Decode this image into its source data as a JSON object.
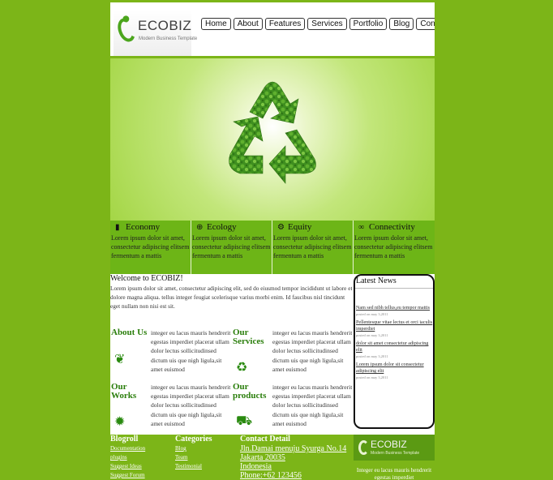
{
  "logo": {
    "name": "ECOBIZ",
    "tagline": "Modern Business Template"
  },
  "nav": [
    "Home",
    "About",
    "Features",
    "Services",
    "Portfolio",
    "Blog",
    "Contact"
  ],
  "colors": {
    "background": "#7cb518",
    "feature_bg": "#6db517",
    "heading_green": "#2a7e0b"
  },
  "features": [
    {
      "icon": "bar-chart-icon",
      "title": "Economy",
      "text": "Lorem ipsum dolor sit amet, consectetur adipiscing elitsem fermentum a mattis"
    },
    {
      "icon": "globe-icon",
      "title": "Ecology",
      "text": "Lorem ipsum dolor sit amet, consectetur adipiscing elitsem fermentum a mattis"
    },
    {
      "icon": "gears-icon",
      "title": "Equity",
      "text": "Lorem ipsum dolor sit amet, consectetur adipiscing elitsem fermentum a mattis"
    },
    {
      "icon": "link-icon",
      "title": "Connectivity",
      "text": "Lorem ipsum dolor sit amet, consectetur adipiscing elitsem fermentum a mattis"
    }
  ],
  "welcome": {
    "title": "Welcome to ECOBIZ!",
    "text": "Lorem ipsum dolor sit amet, consectetur adipiscing elit, sed do eiusmod tempor incididunt ut labore et dolore magna aliqua. tellus integer feugiat scelerisque varius morbi enim. Id faucibus nisl tincidunt eget nullam non nisi est sit."
  },
  "info_blocks": [
    {
      "title": "About Us",
      "icon": "leaf-icon",
      "text": "integer eu lacus mauris hendrerit egestas imperdiet placerat ullam dolor lectus sollicitudinsed dictum uis que nigh ligula,sit amet euismod"
    },
    {
      "title": "Our Services",
      "icon": "recycle-icon",
      "text": "integer eu lacus mauris hendrerit egestas imperdiet placerat ullam dolor lectus sollicitudinsed dictum uis que nigh ligula,sit amet euismod"
    },
    {
      "title": "Our Works",
      "icon": "gear-icon",
      "text": "integer eu lacus mauris hendrerit egestas imperdiet placerat ullam dolor lectus sollicitudinsed dictum uis que nigh ligula,sit amet euismod"
    },
    {
      "title": "Our products",
      "icon": "bus-icon",
      "text": "integer eu lacus mauris hendrerit egestas imperdiet placerat ullam dolor lectus sollicitudinsed dictum uis que nigh ligula,sit amet euismod"
    }
  ],
  "latest_news": {
    "title": "Latest News",
    "items": [
      {
        "text": "Nam sed nibh tellus,eu tempor mattis",
        "date": "posted on may 3,2011"
      },
      {
        "text": "Pellentesque vitae lectus et orci iaculis imperdiet",
        "date": "posted on may 3,2011"
      },
      {
        "text": "dolor sit amet consectetur adipiscing elit",
        "date": "posted on may 3,2011"
      },
      {
        "text": "Lorem ipsum dolor sit consectetur adipiscing elit",
        "date": "posted on may 3,2011"
      }
    ]
  },
  "footer": {
    "blogroll": {
      "title": "Blogroll",
      "items": [
        "Documentation",
        "plugins",
        "Suggest Ideas",
        "Suggest Forum"
      ]
    },
    "categories": {
      "title": "Categories",
      "items": [
        "Blog",
        "Team",
        "Testimonial"
      ]
    },
    "contact": {
      "title": "Contact Detail",
      "items": [
        "Jln.Damai menuju Syurga No.14",
        "Jakarta 20035",
        "Indonesia",
        "Phone:+62 123456"
      ]
    },
    "logo": {
      "name": "ECOBIZ",
      "tagline": "Modern Business Template"
    },
    "text": "Integer eu lacus mauris hendrerit egestas imperdiet"
  }
}
